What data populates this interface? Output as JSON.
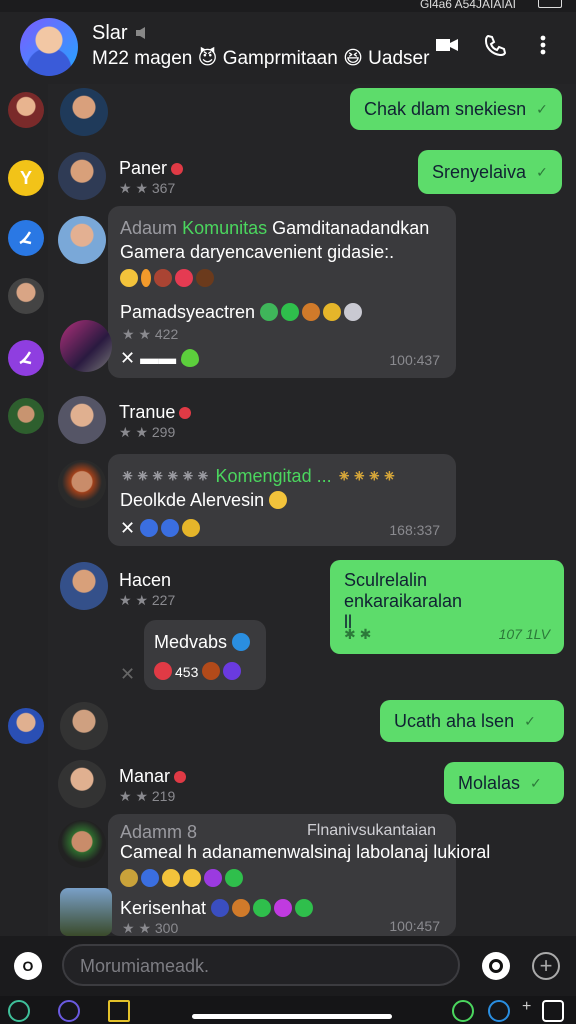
{
  "status": {
    "text": "Gl4a6 A54JAIAIAI"
  },
  "header": {
    "title": "Slar",
    "subtitle": "M22 magen 😈 Gamprmitaan 😆 Uadser"
  },
  "messages": {
    "out1": "Chak dlam snekiesn",
    "out2": "Srenyelaiva",
    "out3_line1": "Sculrelalin enkaraikaralan",
    "out3_line2": "ll",
    "out3_time": "107 1LV",
    "out4": "Ucath aha lsen",
    "out5": "Molalas"
  },
  "contacts": {
    "c1": {
      "name": "Paner",
      "stat": "★ ★ 367"
    },
    "c2": {
      "name": "Tranue",
      "stat": "★ ★ 299"
    },
    "c3": {
      "name": "Hacen",
      "stat": "★ ★ 227"
    },
    "c4": {
      "name": "Manar",
      "stat": "★ ★ 219"
    }
  },
  "group1": {
    "sender": "Adaum",
    "tag": "Komunitas",
    "rest": "Gamditanadandkan",
    "line2": "Gamera daryencavenient gidasie:.",
    "sub_name": "Pamadsyeactren",
    "sub_stat": "★ ★ 422",
    "time": "100:437"
  },
  "group2": {
    "blur": "⁕⁕⁕⁕⁕⁕",
    "tag": "Komengitad ...",
    "line2": "Deolkde Alervesin",
    "time": "168:337"
  },
  "mini": {
    "name": "Medvabs",
    "count": "453"
  },
  "group3": {
    "sender": "Adamm",
    "right": "Flnanivsukantaian",
    "line2": "Cameal h adanamenwalsinaj labolanaj lukioral",
    "sub_name": "Kerisenhat",
    "sub_stat": "★ ★ 300",
    "time": "100:457"
  },
  "composer": {
    "placeholder": "Morumiameadk."
  },
  "colors": {
    "accent": "#5ddc6b",
    "bubble_in": "#3a3a3d",
    "background": "#252527"
  }
}
